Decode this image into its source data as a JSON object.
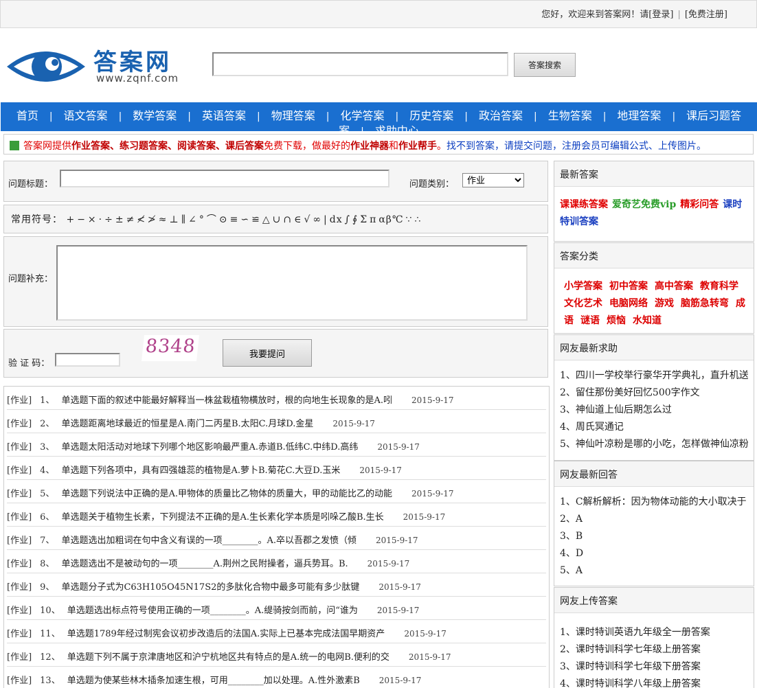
{
  "topbar": {
    "welcome": "您好，欢迎来到答案网！请",
    "login": "[登录]",
    "sep": "|",
    "register": "[免费注册]"
  },
  "logo": {
    "brand": "答案网",
    "domain": "www.zqnf.com"
  },
  "search": {
    "value": "",
    "button": "答案搜索"
  },
  "nav": [
    "首页",
    "语文答案",
    "数学答案",
    "英语答案",
    "物理答案",
    "化学答案",
    "历史答案",
    "政治答案",
    "生物答案",
    "地理答案",
    "课后习题答案",
    "求助中心"
  ],
  "notice": {
    "p1": "答案网提供",
    "b1": "作业答案",
    "s1": "、",
    "b2": "练习题答案",
    "s2": "、",
    "b3": "阅读答案",
    "s3": "、",
    "b4": "课后答案",
    "p2": "免费下载，做最好的",
    "b5": "作业神器",
    "p3": "和",
    "b6": "作业帮手",
    "p4": "。",
    "blue": "找不到答案，请提交问题，注册会员可编辑公式、上传图片。"
  },
  "form": {
    "title_label": "问题标题：",
    "category_label": "问题类别：",
    "category_value": "作业",
    "symbols_label": "常用符号：",
    "symbols": [
      "+",
      "−",
      "×",
      "·",
      "÷",
      "±",
      "≠",
      "≮",
      "≯",
      "≈",
      "⊥",
      "∥",
      "∠",
      "°",
      "⌒",
      "⊙",
      "≡",
      "∽",
      "≌",
      "△",
      "∪",
      "∩",
      "∈",
      "√",
      "∞",
      "|",
      "dx",
      "∫",
      "∮",
      "Σ",
      "π",
      "αβ℃",
      "∵",
      "∴"
    ],
    "supplement_label": "问题补充：",
    "captcha_label": "验 证 码：",
    "captcha_text": "8348",
    "submit": "我要提问"
  },
  "questions": [
    {
      "cat": "[作业]",
      "num": "1、",
      "title": "单选题下面的叙述中能最好解释当一株盆栽植物横放时，根的向地生长现象的是A.吲",
      "date": "2015-9-17"
    },
    {
      "cat": "[作业]",
      "num": "2、",
      "title": "单选题距离地球最近的恒星是A.南门二丙星B.太阳C.月球D.金星",
      "date": "2015-9-17"
    },
    {
      "cat": "[作业]",
      "num": "3、",
      "title": "单选题太阳活动对地球下列哪个地区影响最严重A.赤道B.低纬C.中纬D.高纬",
      "date": "2015-9-17"
    },
    {
      "cat": "[作业]",
      "num": "4、",
      "title": "单选题下列各项中，具有四强雄蕊的植物是A.萝卜B.菊花C.大豆D.玉米",
      "date": "2015-9-17"
    },
    {
      "cat": "[作业]",
      "num": "5、",
      "title": "单选题下列说法中正确的是A.甲物体的质量比乙物体的质量大，甲的动能比乙的动能",
      "date": "2015-9-17"
    },
    {
      "cat": "[作业]",
      "num": "6、",
      "title": "单选题关于植物生长素，下列提法不正确的是A.生长素化学本质是吲哚乙酸B.生长",
      "date": "2015-9-17"
    },
    {
      "cat": "[作业]",
      "num": "7、",
      "title": "单选题选出加粗词在句中含义有误的一项________。A.卒以吾郡之发愤（倾",
      "date": "2015-9-17"
    },
    {
      "cat": "[作业]",
      "num": "8、",
      "title": "单选题选出不是被动句的一项________A.荆州之民附操者，逼兵势耳。B.",
      "date": "2015-9-17"
    },
    {
      "cat": "[作业]",
      "num": "9、",
      "title": "单选题分子式为C63H105O45N17S2的多肽化合物中最多可能有多少肽键",
      "date": "2015-9-17"
    },
    {
      "cat": "[作业]",
      "num": "10、",
      "title": "单选题选出标点符号使用正确的一项________。A.缇骑按剑而前，问“谁为",
      "date": "2015-9-17"
    },
    {
      "cat": "[作业]",
      "num": "11、",
      "title": "单选题1789年经过制宪会议初步改造后的法国A.实际上已基本完成法国早期资产",
      "date": "2015-9-17"
    },
    {
      "cat": "[作业]",
      "num": "12、",
      "title": "单选题下列不属于京津唐地区和沪宁杭地区共有特点的是A.统一的电网B.便利的交",
      "date": "2015-9-17"
    },
    {
      "cat": "[作业]",
      "num": "13、",
      "title": "单选题为使某些林木插条加速生根，可用________加以处理。A.性外激素B",
      "date": "2015-9-17"
    }
  ],
  "sidebar": {
    "latest_head": "最新答案",
    "latest_links": [
      {
        "text": "课课练答案",
        "color": "#e00000"
      },
      {
        "text": "爱奇艺免费vip",
        "color": "#2a9d2a"
      },
      {
        "text": "精彩问答",
        "color": "#e00000"
      },
      {
        "text": "课时特训答案",
        "color": "#1a3fc0"
      }
    ],
    "cat_head": "答案分类",
    "cat_links": [
      "小学答案",
      "初中答案",
      "高中答案",
      "教育科学",
      "文化艺术",
      "电脑网络",
      "游戏",
      "脑筋急转弯",
      "成语",
      "谜语",
      "烦恼",
      "水知道"
    ],
    "help_head": "网友最新求助",
    "help_items": [
      "1、四川一学校举行豪华开学典礼，直升机送",
      "2、留住那份美好回忆500字作文",
      "3、神仙道上仙后期怎么过",
      "4、周氏冥通记",
      "5、神仙叶凉粉是哪的小吃，怎样做神仙凉粉"
    ],
    "answer_head": "网友最新回答",
    "answer_items": [
      "1、C解析解析：因为物体动能的大小取决于",
      "2、A",
      "3、B",
      "4、D",
      "5、A"
    ],
    "upload_head": "网友上传答案",
    "upload_items": [
      "1、课时特训英语九年级全一册答案",
      "2、课时特训科学七年级上册答案",
      "3、课时特训科学七年级下册答案",
      "4、课时特训科学八年级上册答案"
    ]
  }
}
